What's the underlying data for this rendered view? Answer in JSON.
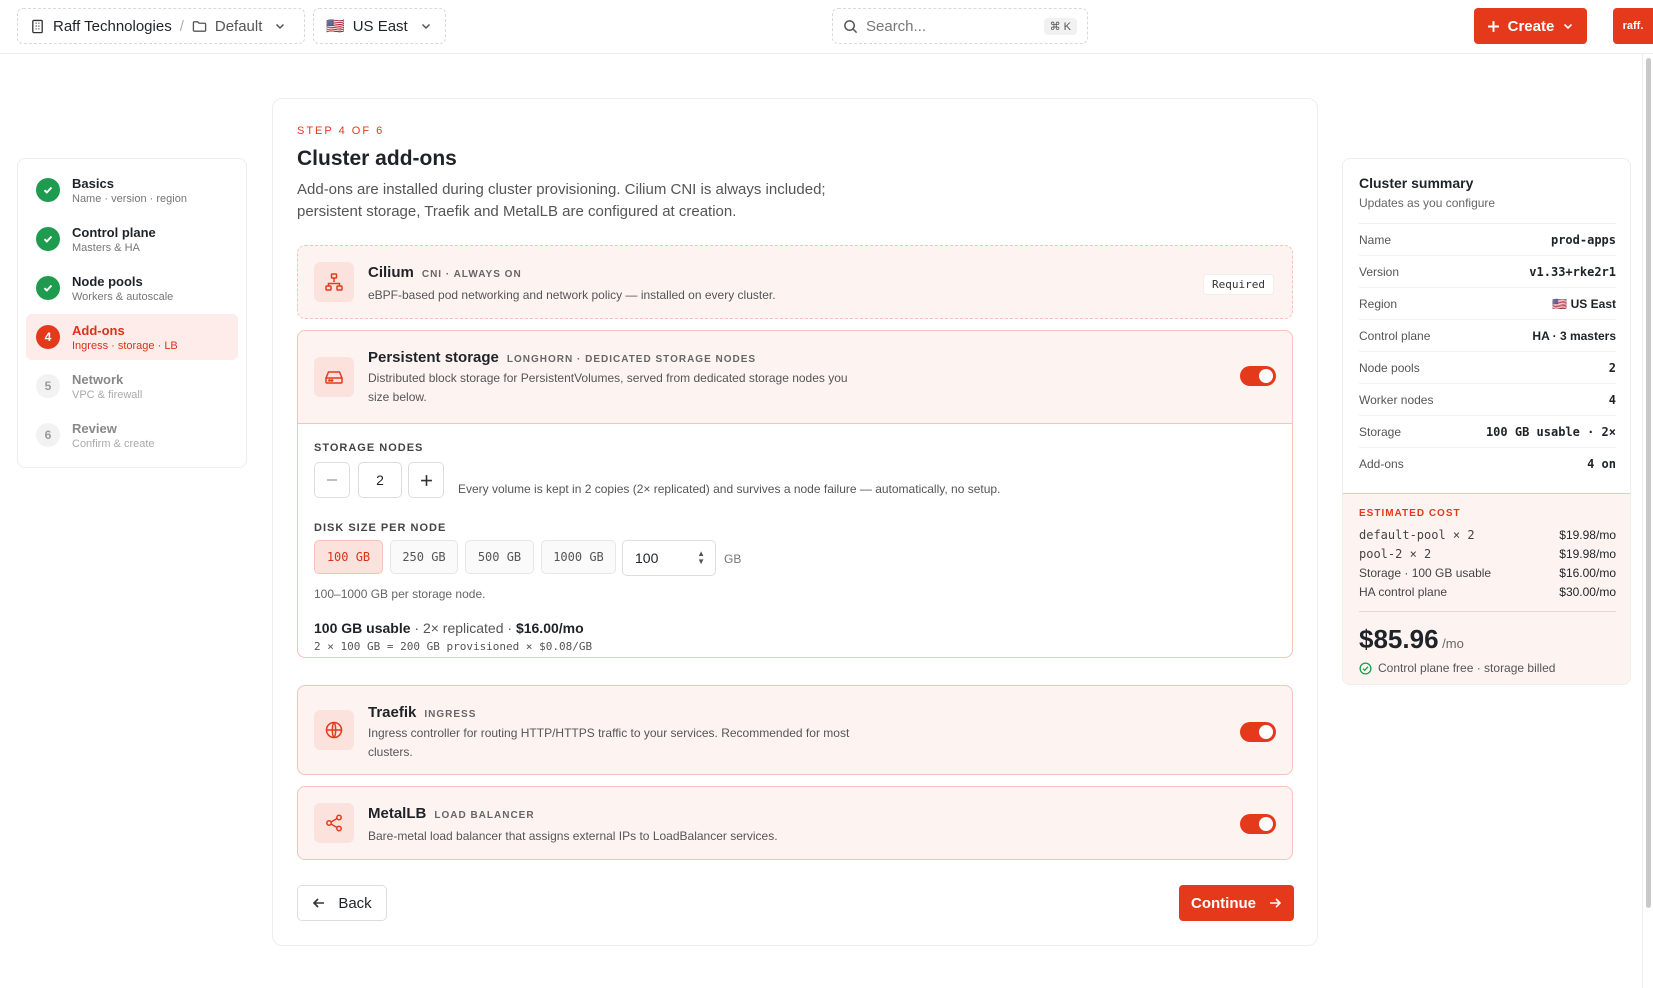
{
  "topbar": {
    "org": "Raff Technologies",
    "project": "Default",
    "region": "US East",
    "region_flag": "🇺🇸",
    "search_placeholder": "Search...",
    "search_shortcut": "⌘ K",
    "create_label": "Create",
    "avatar_text": "raff."
  },
  "stepper": {
    "steps": [
      {
        "num": "1",
        "title": "Basics",
        "sub": "Name · version · region",
        "state": "done"
      },
      {
        "num": "2",
        "title": "Control plane",
        "sub": "Masters & HA",
        "state": "done"
      },
      {
        "num": "3",
        "title": "Node pools",
        "sub": "Workers & autoscale",
        "state": "done"
      },
      {
        "num": "4",
        "title": "Add-ons",
        "sub": "Ingress · storage · LB",
        "state": "active"
      },
      {
        "num": "5",
        "title": "Network",
        "sub": "VPC & firewall",
        "state": "pending"
      },
      {
        "num": "6",
        "title": "Review",
        "sub": "Confirm & create",
        "state": "pending"
      }
    ]
  },
  "main": {
    "eyebrow": "STEP 4 OF 6",
    "title": "Cluster add-ons",
    "description": "Add-ons are installed during cluster provisioning. Cilium CNI is always included; persistent storage, Traefik and MetalLB are configured at creation.",
    "cilium": {
      "name": "Cilium",
      "tag": "CNI · ALWAYS ON",
      "desc": "eBPF-based pod networking and network policy — installed on every cluster.",
      "badge": "Required"
    },
    "storage": {
      "name": "Persistent storage",
      "tag": "LONGHORN · DEDICATED STORAGE NODES",
      "desc": "Distributed block storage for PersistentVolumes, served from dedicated storage nodes you size below.",
      "enabled": true,
      "nodes_label": "STORAGE NODES",
      "nodes_value": "2",
      "nodes_note": "Every volume is kept in 2 copies (2× replicated) and survives a node failure — automatically, no setup.",
      "disk_label": "DISK SIZE PER NODE",
      "disk_options": [
        "100 GB",
        "250 GB",
        "500 GB",
        "1000 GB"
      ],
      "disk_selected": "100 GB",
      "disk_value": "100",
      "disk_unit": "GB",
      "disk_hint": "100–1000 GB per storage node.",
      "usable": "100 GB usable",
      "replicated": "· 2× replicated ·",
      "price": "$16.00/mo",
      "formula": "2 × 100 GB = 200 GB provisioned × $0.08/GB"
    },
    "traefik": {
      "name": "Traefik",
      "tag": "INGRESS",
      "desc": "Ingress controller for routing HTTP/HTTPS traffic to your services. Recommended for most clusters.",
      "enabled": true
    },
    "metallb": {
      "name": "MetalLB",
      "tag": "LOAD BALANCER",
      "desc": "Bare-metal load balancer that assigns external IPs to LoadBalancer services.",
      "enabled": true
    },
    "back_label": "Back",
    "continue_label": "Continue"
  },
  "summary": {
    "title": "Cluster summary",
    "subtitle": "Updates as you configure",
    "rows": [
      {
        "k": "Name",
        "v": "prod-apps"
      },
      {
        "k": "Version",
        "v": "v1.33+rke2r1"
      },
      {
        "k": "Region",
        "v": "🇺🇸 US East"
      },
      {
        "k": "Control plane",
        "v": "HA · 3 masters"
      },
      {
        "k": "Node pools",
        "v": "2"
      },
      {
        "k": "Worker nodes",
        "v": "4"
      },
      {
        "k": "Storage",
        "v": "100 GB usable · 2×"
      },
      {
        "k": "Add-ons",
        "v": "4 on"
      }
    ],
    "cost_label": "ESTIMATED COST",
    "cost_rows": [
      {
        "k": "default-pool × 2",
        "v": "$19.98/mo"
      },
      {
        "k": "pool-2 × 2",
        "v": "$19.98/mo"
      },
      {
        "k": "Storage · 100 GB usable",
        "v": "$16.00/mo"
      },
      {
        "k": "HA control plane",
        "v": "$30.00/mo"
      }
    ],
    "total": "$85.96",
    "per": "/mo",
    "note": "Control plane free · storage billed"
  },
  "colors": {
    "accent": "#e5391c",
    "success": "#1e9b4e"
  }
}
